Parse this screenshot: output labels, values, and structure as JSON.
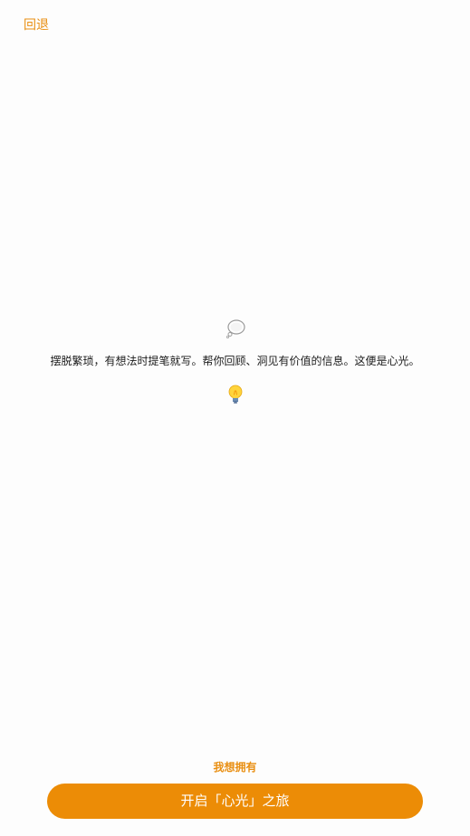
{
  "header": {
    "back_label": "回退"
  },
  "main": {
    "bubble_icon": "thought-bubble-icon",
    "tagline": "摆脱繁琐，有想法时提笔就写。帮你回顾、洞见有价值的信息。这便是心光。",
    "bulb_icon": "light-bulb-icon"
  },
  "footer": {
    "secondary_label": "我想拥有",
    "primary_label": "开启「心光」之旅"
  },
  "colors": {
    "accent": "#ec8c06",
    "accent_text": "#e98f12",
    "background": "#fdfdfd"
  }
}
